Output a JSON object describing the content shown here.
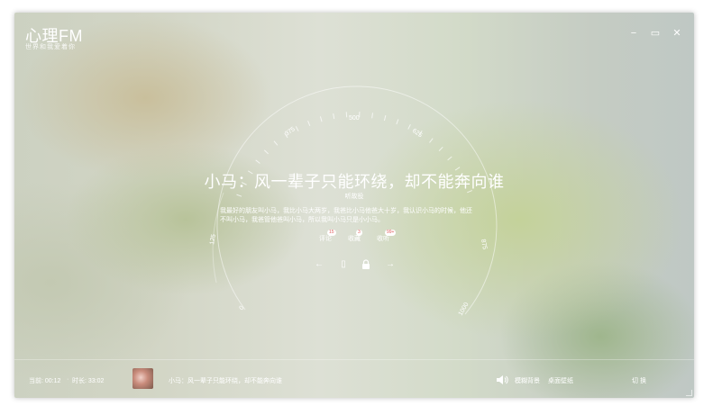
{
  "app": {
    "title": "心理FM",
    "subtitle": "世界和我爱着你"
  },
  "window_controls": {
    "minimize": "−",
    "restore": "▭",
    "close": "✕"
  },
  "dial": {
    "ticks": [
      "125",
      "375",
      "500",
      "625",
      "875",
      "0",
      "1000"
    ]
  },
  "song": {
    "title": "小马：风一辈子只能环绕，却不能奔向谁",
    "author": "听故役",
    "description_line1": "我最好的朋友叫小马，我比小马大两岁，我爸比小马他爸大十岁，我认识小马的时候，他还",
    "description_line2": "不叫小马，我爸管他爸叫小马，所以我叫小马只是小小马。"
  },
  "actions": [
    {
      "label": "评论",
      "count": "15"
    },
    {
      "label": "收藏",
      "count": "3"
    },
    {
      "label": "收听",
      "count": "99+"
    }
  ],
  "controls": {
    "prev": "←",
    "book": "▯",
    "lock": "🔒",
    "next": "→"
  },
  "player": {
    "time": "当前: 00:12",
    "duration": "时长: 33:02",
    "now_playing": "小马：风一辈子只能环绕，却不能奔向谁",
    "volume_icon": "speaker-icon",
    "bg_label": "模糊背景",
    "wallpaper_label": "桌面壁纸",
    "switch_label": "切 换"
  },
  "colors": {
    "text": "#ffffff",
    "badge_text": "#e06060"
  }
}
